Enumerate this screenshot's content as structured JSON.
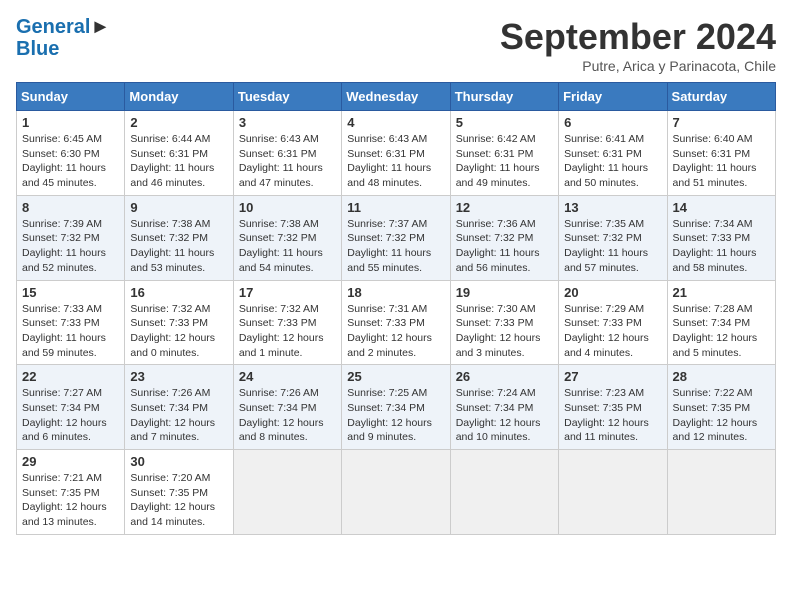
{
  "header": {
    "logo_line1": "General",
    "logo_line2": "Blue",
    "month": "September 2024",
    "location": "Putre, Arica y Parinacota, Chile"
  },
  "days_of_week": [
    "Sunday",
    "Monday",
    "Tuesday",
    "Wednesday",
    "Thursday",
    "Friday",
    "Saturday"
  ],
  "weeks": [
    [
      {
        "day": "1",
        "info": "Sunrise: 6:45 AM\nSunset: 6:30 PM\nDaylight: 11 hours\nand 45 minutes."
      },
      {
        "day": "2",
        "info": "Sunrise: 6:44 AM\nSunset: 6:31 PM\nDaylight: 11 hours\nand 46 minutes."
      },
      {
        "day": "3",
        "info": "Sunrise: 6:43 AM\nSunset: 6:31 PM\nDaylight: 11 hours\nand 47 minutes."
      },
      {
        "day": "4",
        "info": "Sunrise: 6:43 AM\nSunset: 6:31 PM\nDaylight: 11 hours\nand 48 minutes."
      },
      {
        "day": "5",
        "info": "Sunrise: 6:42 AM\nSunset: 6:31 PM\nDaylight: 11 hours\nand 49 minutes."
      },
      {
        "day": "6",
        "info": "Sunrise: 6:41 AM\nSunset: 6:31 PM\nDaylight: 11 hours\nand 50 minutes."
      },
      {
        "day": "7",
        "info": "Sunrise: 6:40 AM\nSunset: 6:31 PM\nDaylight: 11 hours\nand 51 minutes."
      }
    ],
    [
      {
        "day": "8",
        "info": "Sunrise: 7:39 AM\nSunset: 7:32 PM\nDaylight: 11 hours\nand 52 minutes."
      },
      {
        "day": "9",
        "info": "Sunrise: 7:38 AM\nSunset: 7:32 PM\nDaylight: 11 hours\nand 53 minutes."
      },
      {
        "day": "10",
        "info": "Sunrise: 7:38 AM\nSunset: 7:32 PM\nDaylight: 11 hours\nand 54 minutes."
      },
      {
        "day": "11",
        "info": "Sunrise: 7:37 AM\nSunset: 7:32 PM\nDaylight: 11 hours\nand 55 minutes."
      },
      {
        "day": "12",
        "info": "Sunrise: 7:36 AM\nSunset: 7:32 PM\nDaylight: 11 hours\nand 56 minutes."
      },
      {
        "day": "13",
        "info": "Sunrise: 7:35 AM\nSunset: 7:32 PM\nDaylight: 11 hours\nand 57 minutes."
      },
      {
        "day": "14",
        "info": "Sunrise: 7:34 AM\nSunset: 7:33 PM\nDaylight: 11 hours\nand 58 minutes."
      }
    ],
    [
      {
        "day": "15",
        "info": "Sunrise: 7:33 AM\nSunset: 7:33 PM\nDaylight: 11 hours\nand 59 minutes."
      },
      {
        "day": "16",
        "info": "Sunrise: 7:32 AM\nSunset: 7:33 PM\nDaylight: 12 hours\nand 0 minutes."
      },
      {
        "day": "17",
        "info": "Sunrise: 7:32 AM\nSunset: 7:33 PM\nDaylight: 12 hours\nand 1 minute."
      },
      {
        "day": "18",
        "info": "Sunrise: 7:31 AM\nSunset: 7:33 PM\nDaylight: 12 hours\nand 2 minutes."
      },
      {
        "day": "19",
        "info": "Sunrise: 7:30 AM\nSunset: 7:33 PM\nDaylight: 12 hours\nand 3 minutes."
      },
      {
        "day": "20",
        "info": "Sunrise: 7:29 AM\nSunset: 7:33 PM\nDaylight: 12 hours\nand 4 minutes."
      },
      {
        "day": "21",
        "info": "Sunrise: 7:28 AM\nSunset: 7:34 PM\nDaylight: 12 hours\nand 5 minutes."
      }
    ],
    [
      {
        "day": "22",
        "info": "Sunrise: 7:27 AM\nSunset: 7:34 PM\nDaylight: 12 hours\nand 6 minutes."
      },
      {
        "day": "23",
        "info": "Sunrise: 7:26 AM\nSunset: 7:34 PM\nDaylight: 12 hours\nand 7 minutes."
      },
      {
        "day": "24",
        "info": "Sunrise: 7:26 AM\nSunset: 7:34 PM\nDaylight: 12 hours\nand 8 minutes."
      },
      {
        "day": "25",
        "info": "Sunrise: 7:25 AM\nSunset: 7:34 PM\nDaylight: 12 hours\nand 9 minutes."
      },
      {
        "day": "26",
        "info": "Sunrise: 7:24 AM\nSunset: 7:34 PM\nDaylight: 12 hours\nand 10 minutes."
      },
      {
        "day": "27",
        "info": "Sunrise: 7:23 AM\nSunset: 7:35 PM\nDaylight: 12 hours\nand 11 minutes."
      },
      {
        "day": "28",
        "info": "Sunrise: 7:22 AM\nSunset: 7:35 PM\nDaylight: 12 hours\nand 12 minutes."
      }
    ],
    [
      {
        "day": "29",
        "info": "Sunrise: 7:21 AM\nSunset: 7:35 PM\nDaylight: 12 hours\nand 13 minutes."
      },
      {
        "day": "30",
        "info": "Sunrise: 7:20 AM\nSunset: 7:35 PM\nDaylight: 12 hours\nand 14 minutes."
      },
      {
        "day": "",
        "info": ""
      },
      {
        "day": "",
        "info": ""
      },
      {
        "day": "",
        "info": ""
      },
      {
        "day": "",
        "info": ""
      },
      {
        "day": "",
        "info": ""
      }
    ]
  ]
}
